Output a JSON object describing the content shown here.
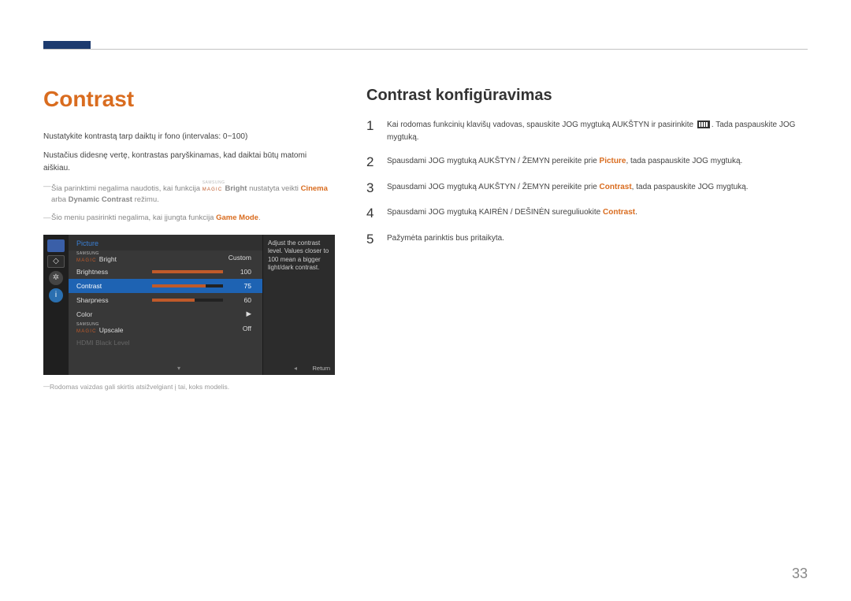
{
  "title": "Contrast",
  "subtitle": "Contrast konfigūravimas",
  "intro": {
    "line1": "Nustatykite kontrastą tarp daiktų ir fono (intervalas: 0~100)",
    "line2": "Nustačius didesnę vertę, kontrastas paryškinamas, kad daiktai būtų matomi aiškiau."
  },
  "notes": {
    "n1_a": "Šia parinktimi negalima naudotis, kai funkcija ",
    "n1_bright": "Bright",
    "n1_b": " nustatyta veikti ",
    "n1_cinema": "Cinema",
    "n1_c": " arba ",
    "n1_dyn": "Dynamic Contrast",
    "n1_d": " režimu.",
    "n2_a": "Šio meniu pasirinkti negalima, kai įjungta funkcija ",
    "n2_game": "Game Mode",
    "n2_b": "."
  },
  "osd": {
    "header": "Picture",
    "help": "Adjust the contrast level. Values closer to 100 mean a bigger light/dark contrast.",
    "rows": {
      "magicbright_label": "Bright",
      "magicbright_val": "Custom",
      "brightness_label": "Brightness",
      "brightness_val": "100",
      "contrast_label": "Contrast",
      "contrast_val": "75",
      "sharpness_label": "Sharpness",
      "sharpness_val": "60",
      "color_label": "Color",
      "color_arrow": "▶",
      "upscale_label": "Upscale",
      "upscale_val": "Off",
      "hdmi_label": "HDMI Black Level"
    },
    "return": "Return",
    "samsung": "SAMSUNG",
    "magic": "MAGIC"
  },
  "caption": "Rodomas vaizdas gali skirtis atsižvelgiant į tai, koks modelis.",
  "steps": {
    "s1_a": "Kai rodomas funkcinių klavišų vadovas, spauskite JOG mygtuką AUKŠTYN ir pasirinkite ",
    "s1_b": ". Tada paspauskite JOG mygtuką.",
    "s2_a": "Spausdami JOG mygtuką AUKŠTYN / ŽEMYN pereikite prie ",
    "s2_pic": "Picture",
    "s2_b": ", tada paspauskite JOG mygtuką.",
    "s3_a": "Spausdami JOG mygtuką AUKŠTYN / ŽEMYN pereikite prie ",
    "s3_con": "Contrast",
    "s3_b": ", tada paspauskite JOG mygtuką.",
    "s4_a": "Spausdami JOG mygtuką KAIRĖN / DEŠINĖN sureguliuokite ",
    "s4_con": "Contrast",
    "s4_b": ".",
    "s5": "Pažymėta parinktis bus pritaikyta."
  },
  "nums": {
    "n1": "1",
    "n2": "2",
    "n3": "3",
    "n4": "4",
    "n5": "5"
  },
  "pagenum": "33"
}
